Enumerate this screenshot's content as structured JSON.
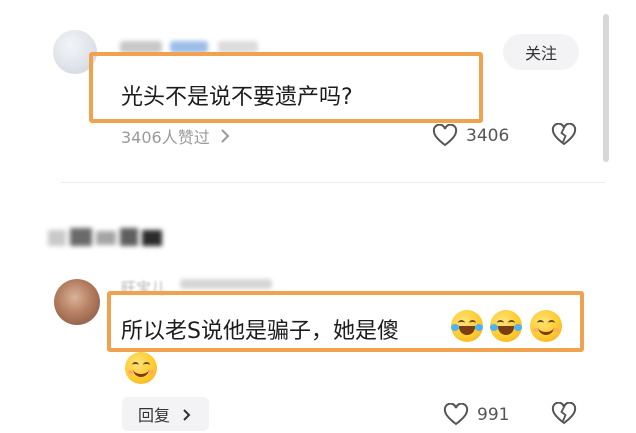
{
  "comment1": {
    "username": "",
    "text": "光头不是说不要遗产吗?",
    "likes_summary": "3406人赞过",
    "like_count": "3406",
    "follow_label": "关注"
  },
  "comment2": {
    "username": "旺宝儿",
    "text": "所以老S说他是骗子，她是傻",
    "like_count": "991",
    "reply_label": "回复"
  },
  "icons": {
    "chevron": "chevron-right-icon",
    "heart": "heart-outline-icon",
    "dislike": "broken-heart-icon",
    "emoji_laugh": "laugh-cry-emoji",
    "emoji_smile": "smile-emoji"
  },
  "colors": {
    "highlight_box": "#f0a24e",
    "meta_text": "#9a9a9a"
  }
}
